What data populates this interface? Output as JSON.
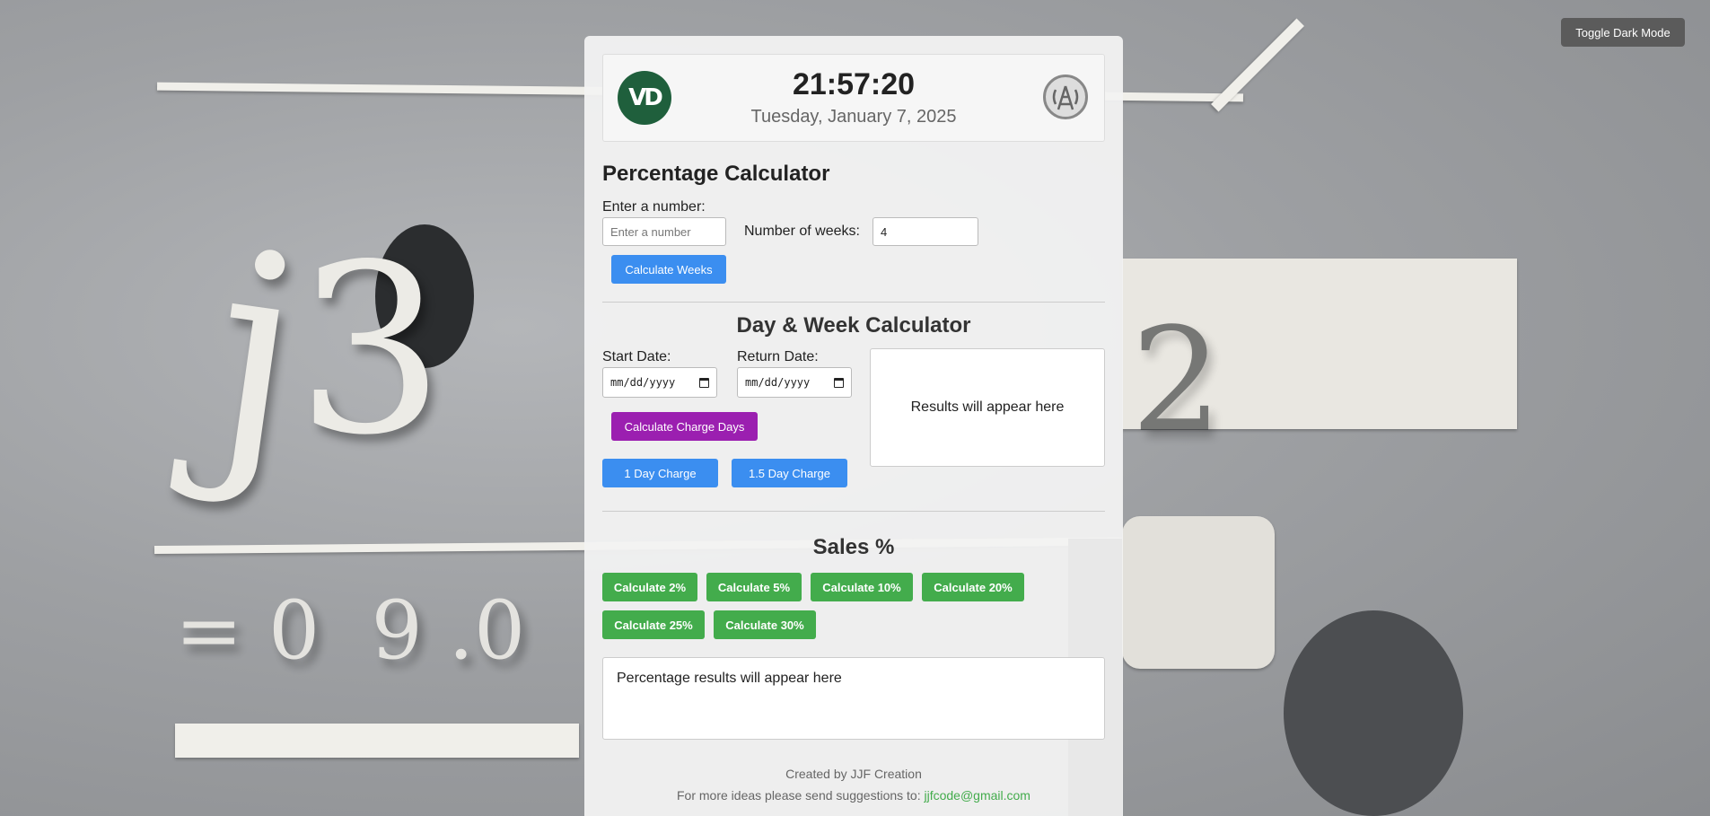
{
  "toggle": {
    "label": "Toggle Dark Mode"
  },
  "header": {
    "time": "21:57:20",
    "date": "Tuesday, January 7, 2025",
    "logo_left_text": "VD"
  },
  "percentage_calc": {
    "title": "Percentage Calculator",
    "number_label": "Enter a number:",
    "number_placeholder": "Enter a number",
    "number_value": "",
    "weeks_label": "Number of weeks:",
    "weeks_value": "4",
    "calculate_weeks_label": "Calculate Weeks"
  },
  "day_week_calc": {
    "title": "Day & Week Calculator",
    "start_label": "Start Date:",
    "return_label": "Return Date:",
    "date_placeholder": "mm/dd/yyyy",
    "calculate_charge_days_label": "Calculate Charge Days",
    "one_day_charge_label": "1 Day Charge",
    "one_half_day_charge_label": "1.5 Day Charge",
    "results_text": "Results will appear here"
  },
  "sales": {
    "title": "Sales %",
    "buttons": [
      "Calculate 2%",
      "Calculate 5%",
      "Calculate 10%",
      "Calculate 20%",
      "Calculate 25%",
      "Calculate 30%"
    ],
    "results_text": "Percentage results will appear here"
  },
  "footer": {
    "created_by": "Created by JJF Creation",
    "suggestions_text": "For more ideas please send suggestions to:",
    "email": "jjfcode@gmail.com"
  },
  "colors": {
    "blue_button": "#3b8ef0",
    "purple_button": "#9b1fb0",
    "green_button": "#43ac4c",
    "logo_green": "#1f5f3c",
    "toggle_button": "#5b5b5b"
  },
  "icons": {
    "logo_left": "vd-logo-icon",
    "logo_right": "signal-tower-logo-icon",
    "date_picker": "calendar-icon"
  }
}
